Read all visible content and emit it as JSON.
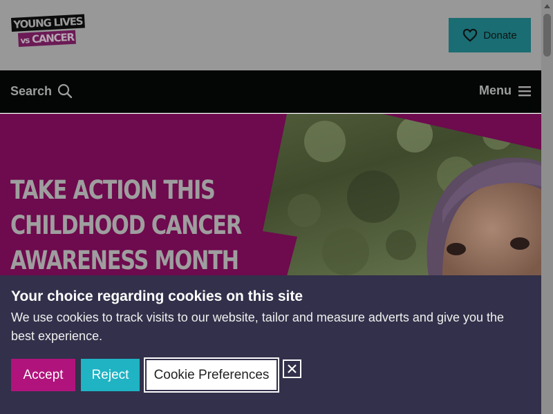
{
  "header": {
    "logo_line1": "YOUNG LIVES",
    "logo_vs": "vs",
    "logo_line2": "CANCER",
    "donate_label": "Donate",
    "donate_icon": "heart-icon"
  },
  "nav": {
    "search_label": "Search",
    "search_icon": "search-icon",
    "menu_label": "Menu",
    "menu_icon": "hamburger-icon"
  },
  "hero": {
    "title_lines": [
      "TAKE ACTION THIS",
      "CHILDHOOD CANCER",
      "AWARENESS MONTH"
    ],
    "accent_color": "#6e0a4e"
  },
  "cookie_banner": {
    "heading": "Your choice regarding cookies on this site",
    "body": "We use cookies to track visits to our website, tailor and measure adverts and give you the best experience.",
    "accept_label": "Accept",
    "reject_label": "Reject",
    "preferences_label": "Cookie Preferences",
    "close_icon": "close-icon",
    "colors": {
      "background": "#32304a",
      "accept": "#b0147c",
      "reject": "#1fb3c4"
    }
  }
}
